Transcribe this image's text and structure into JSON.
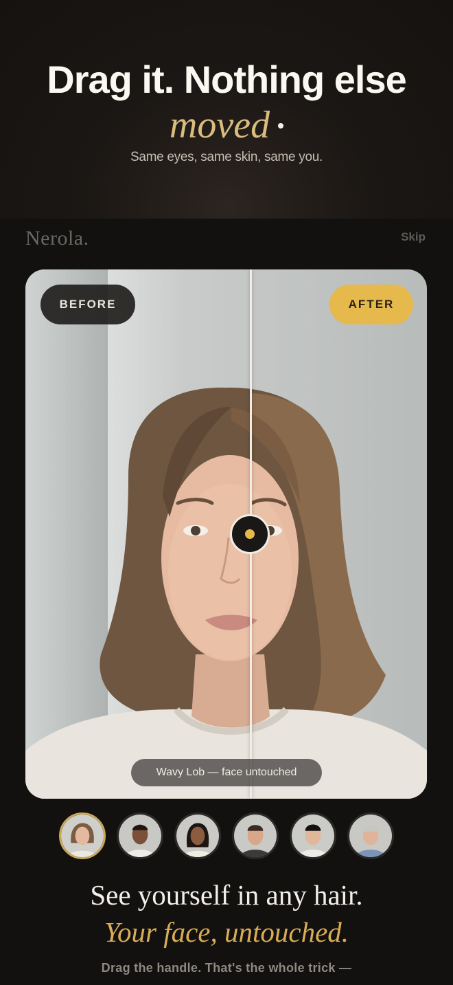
{
  "promo": {
    "title": "Drag it. Nothing else",
    "accent": "moved",
    "subtitle": "Same eyes, same skin, same you."
  },
  "header": {
    "brand": "Nerola.",
    "skip_label": "Skip"
  },
  "compare": {
    "before_label": "BEFORE",
    "after_label": "AFTER",
    "caption": "Wavy Lob — face untouched",
    "accent_color": "#e6b94c"
  },
  "avatars": [
    {
      "name": "avatar-woman-brown-hair",
      "selected": true
    },
    {
      "name": "avatar-man-dark-skin",
      "selected": false
    },
    {
      "name": "avatar-woman-long-dark-hair",
      "selected": false
    },
    {
      "name": "avatar-man-short-hair",
      "selected": false
    },
    {
      "name": "avatar-man-black-hair",
      "selected": false
    },
    {
      "name": "avatar-older-man-gray-hair",
      "selected": false
    }
  ],
  "copy": {
    "headline": "See yourself in any hair.",
    "headline_accent": "Your face, untouched.",
    "footnote": "Drag the handle. That's the whole trick —"
  }
}
